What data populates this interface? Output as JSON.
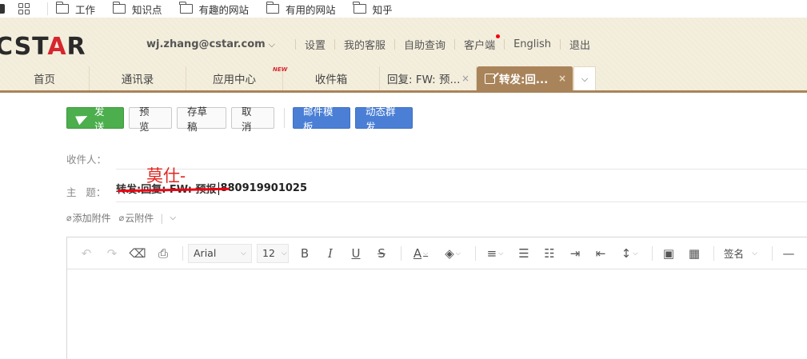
{
  "bookmarks": [
    "工作",
    "知识点",
    "有趣的网站",
    "有用的网站",
    "知乎"
  ],
  "logo": {
    "part1": "C",
    "part2": "ST",
    "accent": "A",
    "part3": "R"
  },
  "topnav": {
    "user": "wj.zhang@cstar.com",
    "links": [
      "设置",
      "我的客服",
      "自助查询",
      "客户端",
      "English",
      "退出"
    ]
  },
  "tabs": {
    "home": "首页",
    "contacts": "通讯录",
    "apps": "应用中心",
    "apps_badge": "NEW",
    "inbox": "收件箱",
    "reply": "回复: FW: 预...",
    "forward": "转发:回...",
    "close": "×"
  },
  "toolbar": {
    "send": "发送",
    "preview": "预 览",
    "draft": "存草稿",
    "cancel": "取 消",
    "template": "邮件模板",
    "group_send": "动态群发"
  },
  "fields": {
    "recipient_label": "收件人：",
    "subject_label": "主   题：",
    "subject_struck": "转发:回复: FW: 预报",
    "subject_text": "880919901025",
    "handwritten": "莫仕-"
  },
  "attach": {
    "add": "添加附件",
    "cloud": "云附件"
  },
  "editor": {
    "font": "Arial",
    "size": "12",
    "signature": "签名"
  },
  "colors": {
    "accent_tab": "#a9845a",
    "send": "#4cae4c",
    "blue": "#4b7fd6",
    "annotation": "#e0261f"
  }
}
